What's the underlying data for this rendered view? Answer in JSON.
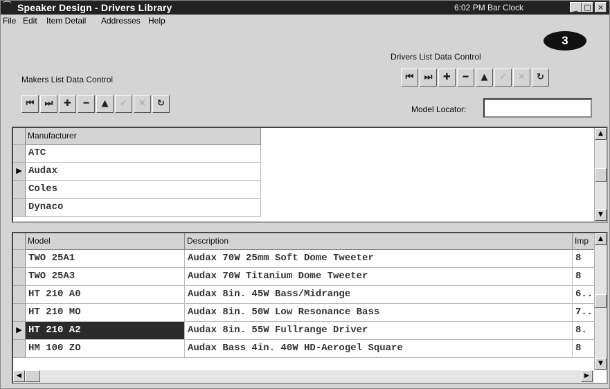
{
  "window": {
    "title": "Speaker Design - Drivers Library",
    "clock": "6:02 PM  Bar Clock",
    "badge": "3",
    "title_buttons": [
      "_",
      "□",
      "×"
    ]
  },
  "menu": [
    "File",
    "Edit",
    "Item Detail",
    "Addresses",
    "Help"
  ],
  "makers_control": {
    "label": "Makers List Data Control",
    "buttons": [
      {
        "icon": "first-record-icon",
        "glyph": "⏮"
      },
      {
        "icon": "last-record-icon",
        "glyph": "⏭"
      },
      {
        "icon": "add-icon",
        "glyph": "✚"
      },
      {
        "icon": "delete-icon",
        "glyph": "━"
      },
      {
        "icon": "up-icon",
        "glyph": "▲"
      },
      {
        "icon": "check-icon",
        "glyph": "✓"
      },
      {
        "icon": "cancel-icon",
        "glyph": "✕"
      },
      {
        "icon": "refresh-icon",
        "glyph": "↻"
      }
    ]
  },
  "drivers_control": {
    "label": "Drivers List Data Control",
    "locator_label": "Model Locator:",
    "locator_value": ""
  },
  "makers_grid": {
    "header": "Manufacturer",
    "rows": [
      "ATC",
      "Audax",
      "Coles",
      "Dynaco"
    ],
    "current_row": 1
  },
  "drivers_grid": {
    "headers": [
      "Model",
      "Description",
      "Imp"
    ],
    "rows": [
      [
        "TWO 25A1",
        "Audax 70W 25mm Soft Dome Tweeter",
        "8"
      ],
      [
        "TWO 25A3",
        "Audax 70W Titanium Dome Tweeter",
        "8"
      ],
      [
        "HT 210 A0",
        "Audax 8in. 45W Bass/Midrange",
        "6.."
      ],
      [
        "HT 210 MO",
        "Audax 8in. 50W Low Resonance Bass",
        "7.."
      ],
      [
        "HT 210 A2",
        "Audax 8in. 55W Fullrange Driver",
        "8."
      ],
      [
        "HM 100 ZO",
        "Audax Bass 4in. 40W HD-Aerogel Square",
        "8"
      ]
    ],
    "current_row": 4
  }
}
